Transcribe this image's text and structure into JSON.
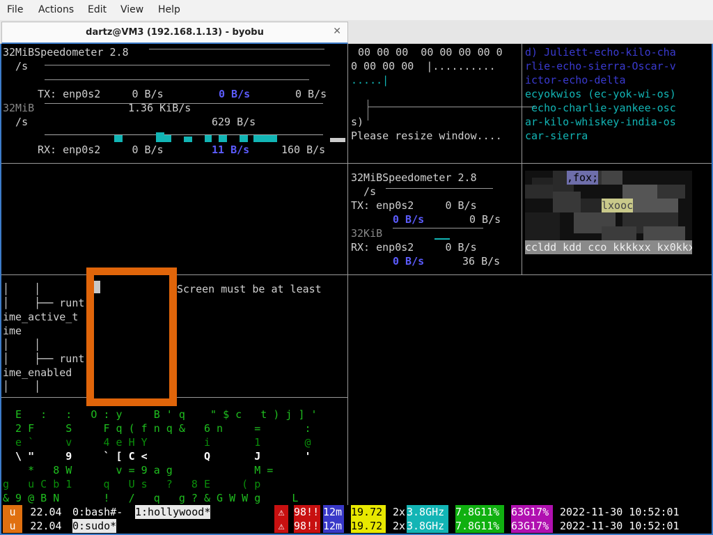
{
  "menu": [
    "File",
    "Actions",
    "Edit",
    "View",
    "Help"
  ],
  "window": {
    "title": "dartz@VM3 (192.168.1.13) - byobu",
    "close": "✕"
  },
  "speedo1": {
    "header": "32MiBSpeedometer 2.8",
    "unit": "  /s",
    "tx_line": "TX: enp0s2     0 B/s",
    "tx_mid": "0 B/s",
    "tx_right": "0 B/s",
    "scale2": "32MiB",
    "kib": "1.36 KiB/s",
    "unit2": "  /s",
    "bps": "629 B/s",
    "rx_line": "RX: enp0s2     0 B/s",
    "rx_mid": "11 B/s",
    "rx_right": "160 B/s"
  },
  "hex": {
    "line1": "00 00 00  00 00 00 00 0",
    "line2": "0 00 00 00  |..........",
    "line3": ".....|",
    "line4": "s)",
    "resize": "Please resize window...."
  },
  "words": [
    "d) Juliett-echo-kilo-cha",
    "rlie-echo-sierra-Oscar-v",
    "ictor-echo-delta",
    "ecyokwios (ec-yok-wi-os)",
    " echo-charlie-yankee-osc",
    "ar-kilo-whiskey-india-os",
    "car-sierra"
  ],
  "speedo2": {
    "header": "32MiBSpeedometer 2.8",
    "unit": "  /s",
    "tx": "TX: enp0s2     0 B/s",
    "tx_mid": "0 B/s",
    "tx_right": "0 B/s",
    "scale": "32KiB",
    "rx": "RX: enp0s2     0 B/s",
    "rx_mid": "0 B/s",
    "rx_right": "36 B/s"
  },
  "aafire": {
    "t1": ",fox;",
    "t2": "lxooc",
    "bottom": "ccldd kdd cco kkkkxx kx0kkxc"
  },
  "tree": {
    "l1": "│    │",
    "l2": "│    ├── runt",
    "l3": "ime_active_t",
    "l4": "ime",
    "l5": "│    │",
    "l6": "│    ├── runt",
    "l7": "ime_enabled",
    "l8": "│    │"
  },
  "screen_msg": "Screen must be at least",
  "matrix": [
    "  E   :   :   O : y     B ' q    \" $ c   t ) j ] '",
    "  2 F     S     F q ( f n q &   6 n     =       :",
    "  e `     v     4 e H Y         i       1       @",
    "  \\ \"     9     ` [ C <         Q       J       '",
    "    *   8 W       v = 9 a g             M =",
    "g   u C b 1     q   U s   ?   8 E     ( p",
    "& 9 @ B N       !   /   q   g ? & G W W g     L"
  ],
  "status": {
    "rows": [
      {
        "logo": "u",
        "ver": "22.04",
        "win0": "0:bash#-",
        "win1": "1:hollywood*"
      },
      {
        "logo": "u",
        "ver": "22.04",
        "win0": "0:sudo*",
        "win1": ""
      }
    ],
    "warn": "⚠",
    "updates": "98!!",
    "uptime": "12m",
    "load": "19.72",
    "cpu": "2x",
    "freq": "3.8GHz",
    "mem": "7.8G11%",
    "disk": "63G17%",
    "clock": "2022-11-30 10:52:01"
  },
  "colors": {
    "accent": "#3d7cc9",
    "cyan": "#12b5b5",
    "highlight_box": "#e0650a"
  }
}
